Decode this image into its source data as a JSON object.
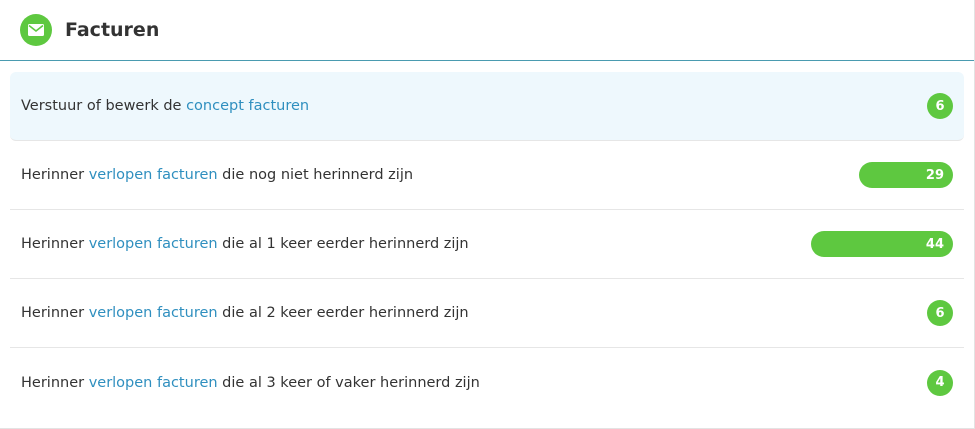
{
  "header": {
    "title": "Facturen",
    "icon": "envelope-icon",
    "accent": "#5ec840"
  },
  "rows": [
    {
      "prefix": "Verstuur of bewerk de ",
      "link": "concept facturen",
      "suffix": "",
      "count": "6",
      "count_value": 6,
      "highlighted": true
    },
    {
      "prefix": "Herinner ",
      "link": "verlopen facturen",
      "suffix": " die nog niet herinnerd zijn",
      "count": "29",
      "count_value": 29,
      "highlighted": false
    },
    {
      "prefix": "Herinner ",
      "link": "verlopen facturen",
      "suffix": " die al 1 keer eerder herinnerd zijn",
      "count": "44",
      "count_value": 44,
      "highlighted": false
    },
    {
      "prefix": "Herinner ",
      "link": "verlopen facturen",
      "suffix": " die al 2 keer eerder herinnerd zijn",
      "count": "6",
      "count_value": 6,
      "highlighted": false
    },
    {
      "prefix": "Herinner ",
      "link": "verlopen facturen",
      "suffix": " die al 3 keer of vaker herinnerd zijn",
      "count": "4",
      "count_value": 4,
      "highlighted": false
    }
  ],
  "colors": {
    "link": "#2f8fbf",
    "badge": "#5ec840",
    "highlight_bg": "#eef8fd"
  }
}
